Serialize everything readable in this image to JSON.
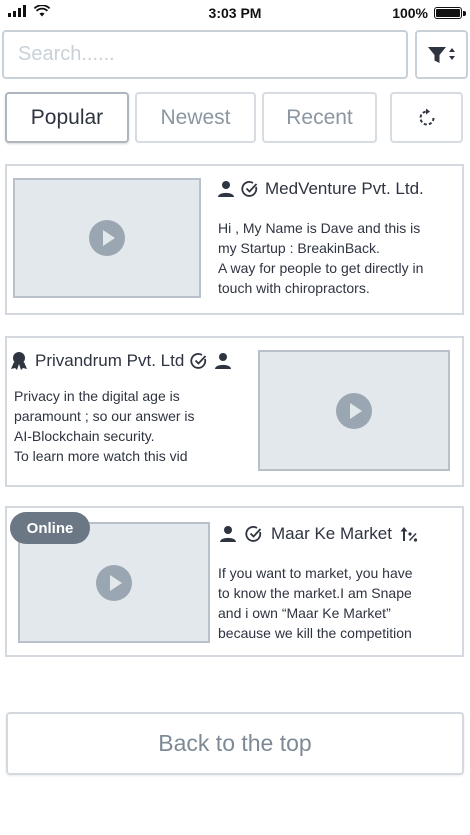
{
  "status_bar": {
    "time": "3:03 PM",
    "battery": "100%"
  },
  "search": {
    "placeholder": "Search......",
    "value": ""
  },
  "tabs": [
    {
      "label": "Popular",
      "active": true
    },
    {
      "label": "Newest",
      "active": false
    },
    {
      "label": "Recent",
      "active": false
    }
  ],
  "posts": [
    {
      "company": "MedVenture Pvt. Ltd.",
      "description": "Hi , My Name is Dave and this is\nmy Startup : BreakinBack.\nA way for people to get directly in\ntouch with chiropractors.",
      "icons": [
        "user-icon",
        "verified-check-icon"
      ]
    },
    {
      "company": "Privandrum Pvt. Ltd",
      "description": "Privacy in the digital age is\nparamount ; so our answer is\nAI-Blockchain security.\nTo learn more watch this vid",
      "icons": [
        "award-icon",
        "verified-check-icon",
        "user-icon"
      ]
    },
    {
      "company": "Maar Ke Market",
      "badge": "Online",
      "description": "If you want to market, you have\nto know the market.I am Snape\nand i own “Maar Ke Market”\nbecause we kill the competition",
      "icons": [
        "user-icon",
        "verified-check-icon",
        "trending-percent-icon"
      ]
    }
  ],
  "footer": {
    "back_to_top": "Back to the top"
  },
  "colors": {
    "border": "#d3d9df",
    "thumb_bg": "#e3e8ec",
    "badge_bg": "#6b7784",
    "muted_text": "#8a97a3"
  }
}
